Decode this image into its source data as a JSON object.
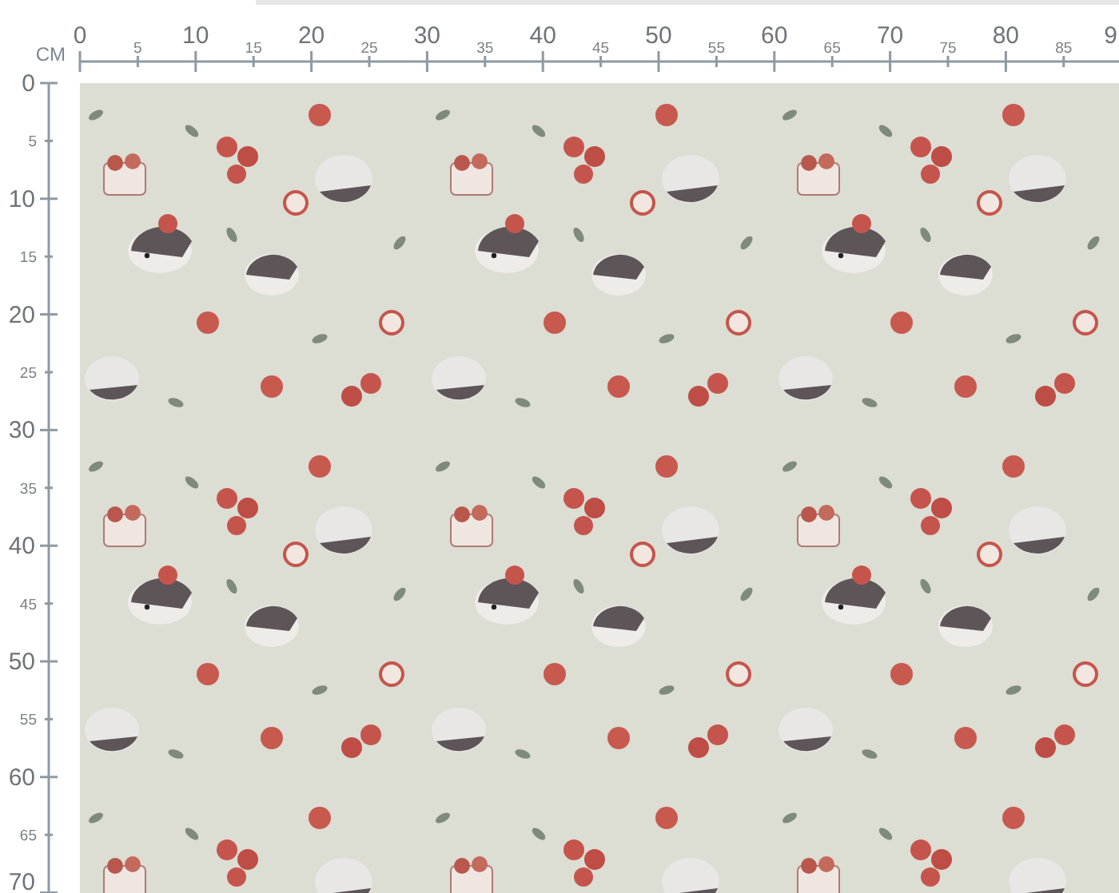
{
  "ruler_unit": "CM",
  "top_ruler": {
    "labels": [
      {
        "text": "0",
        "major": true
      },
      {
        "text": "5",
        "major": false
      },
      {
        "text": "10",
        "major": true
      },
      {
        "text": "15",
        "major": false
      },
      {
        "text": "20",
        "major": true
      },
      {
        "text": "25",
        "major": false
      },
      {
        "text": "30",
        "major": true
      },
      {
        "text": "35",
        "major": false
      },
      {
        "text": "40",
        "major": true
      },
      {
        "text": "45",
        "major": false
      },
      {
        "text": "50",
        "major": true
      },
      {
        "text": "55",
        "major": false
      },
      {
        "text": "60",
        "major": true
      },
      {
        "text": "65",
        "major": false
      },
      {
        "text": "70",
        "major": true
      },
      {
        "text": "75",
        "major": false
      },
      {
        "text": "80",
        "major": true
      },
      {
        "text": "85",
        "major": false
      },
      {
        "text": "9",
        "major": true
      }
    ]
  },
  "left_ruler": {
    "labels": [
      {
        "text": "0",
        "major": true
      },
      {
        "text": "5",
        "major": false
      },
      {
        "text": "10",
        "major": true
      },
      {
        "text": "15",
        "major": false
      },
      {
        "text": "20",
        "major": true
      },
      {
        "text": "25",
        "major": false
      },
      {
        "text": "30",
        "major": true
      },
      {
        "text": "35",
        "major": false
      },
      {
        "text": "40",
        "major": true
      },
      {
        "text": "45",
        "major": false
      },
      {
        "text": "50",
        "major": true
      },
      {
        "text": "55",
        "major": false
      },
      {
        "text": "60",
        "major": true
      },
      {
        "text": "65",
        "major": false
      },
      {
        "text": "70",
        "major": true
      }
    ]
  }
}
